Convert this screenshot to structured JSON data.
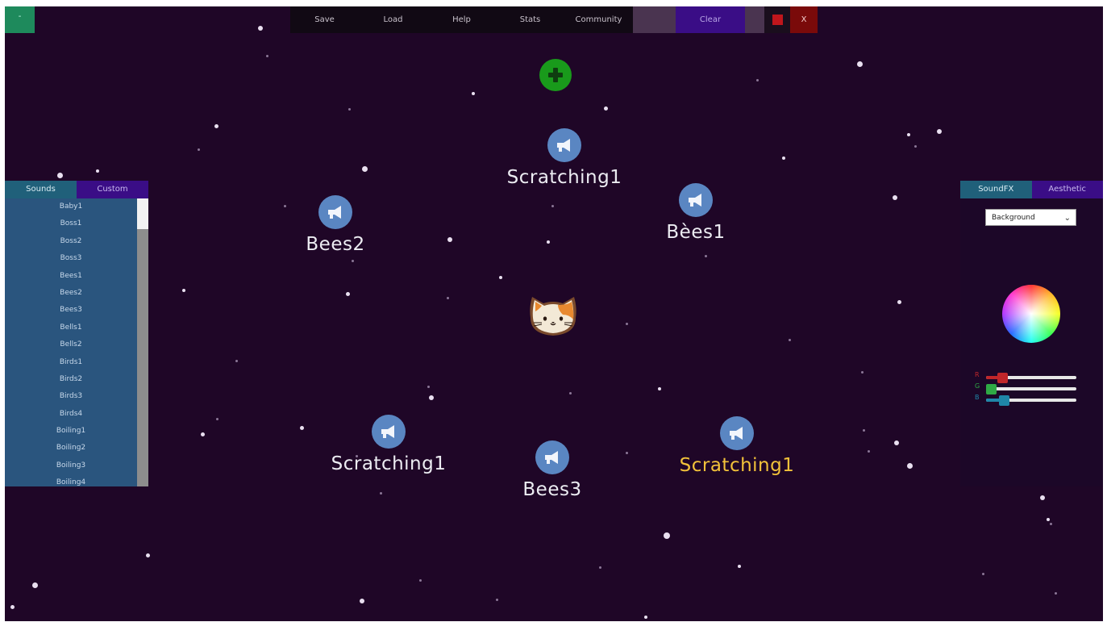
{
  "topbar": {
    "corner_label": "-",
    "menu": [
      "Save",
      "Load",
      "Help",
      "Stats",
      "Community"
    ],
    "clear_label": "Clear",
    "close_label": "X"
  },
  "nodes": [
    {
      "label": "Scratching1",
      "selected": false
    },
    {
      "label": "Bees2",
      "selected": false
    },
    {
      "label": "Bèes1",
      "selected": false
    },
    {
      "label": "Scratching1",
      "selected": false
    },
    {
      "label": "Bees3",
      "selected": false
    },
    {
      "label": "Scratching1",
      "selected": true
    }
  ],
  "left_panel": {
    "tabs": [
      "Sounds",
      "Custom"
    ],
    "sounds": [
      "Baby1",
      "Boss1",
      "Boss2",
      "Boss3",
      "Bees1",
      "Bees2",
      "Bees3",
      "Bells1",
      "Bells2",
      "Birds1",
      "Birds2",
      "Birds3",
      "Birds4",
      "Boiling1",
      "Boiling2",
      "Boiling3",
      "Boiling4"
    ]
  },
  "right_panel": {
    "tabs": [
      "SoundFX",
      "Aesthetic"
    ],
    "dropdown_value": "Background",
    "sliders": [
      {
        "channel": "R",
        "color": "#c0262a",
        "value": 0.18
      },
      {
        "channel": "G",
        "color": "#2fa845",
        "value": 0.05
      },
      {
        "channel": "B",
        "color": "#1f86a8",
        "value": 0.2
      }
    ]
  },
  "colors": {
    "background": "#1f0627",
    "accent_green": "#199a1b",
    "node_blue": "#5a86c2",
    "selected_label": "#f2c23a"
  },
  "icons": {
    "add": "plus-icon",
    "node": "megaphone-icon",
    "center": "cat-face-icon",
    "stop": "stop-square-icon",
    "dropdown": "chevron-down-icon"
  }
}
